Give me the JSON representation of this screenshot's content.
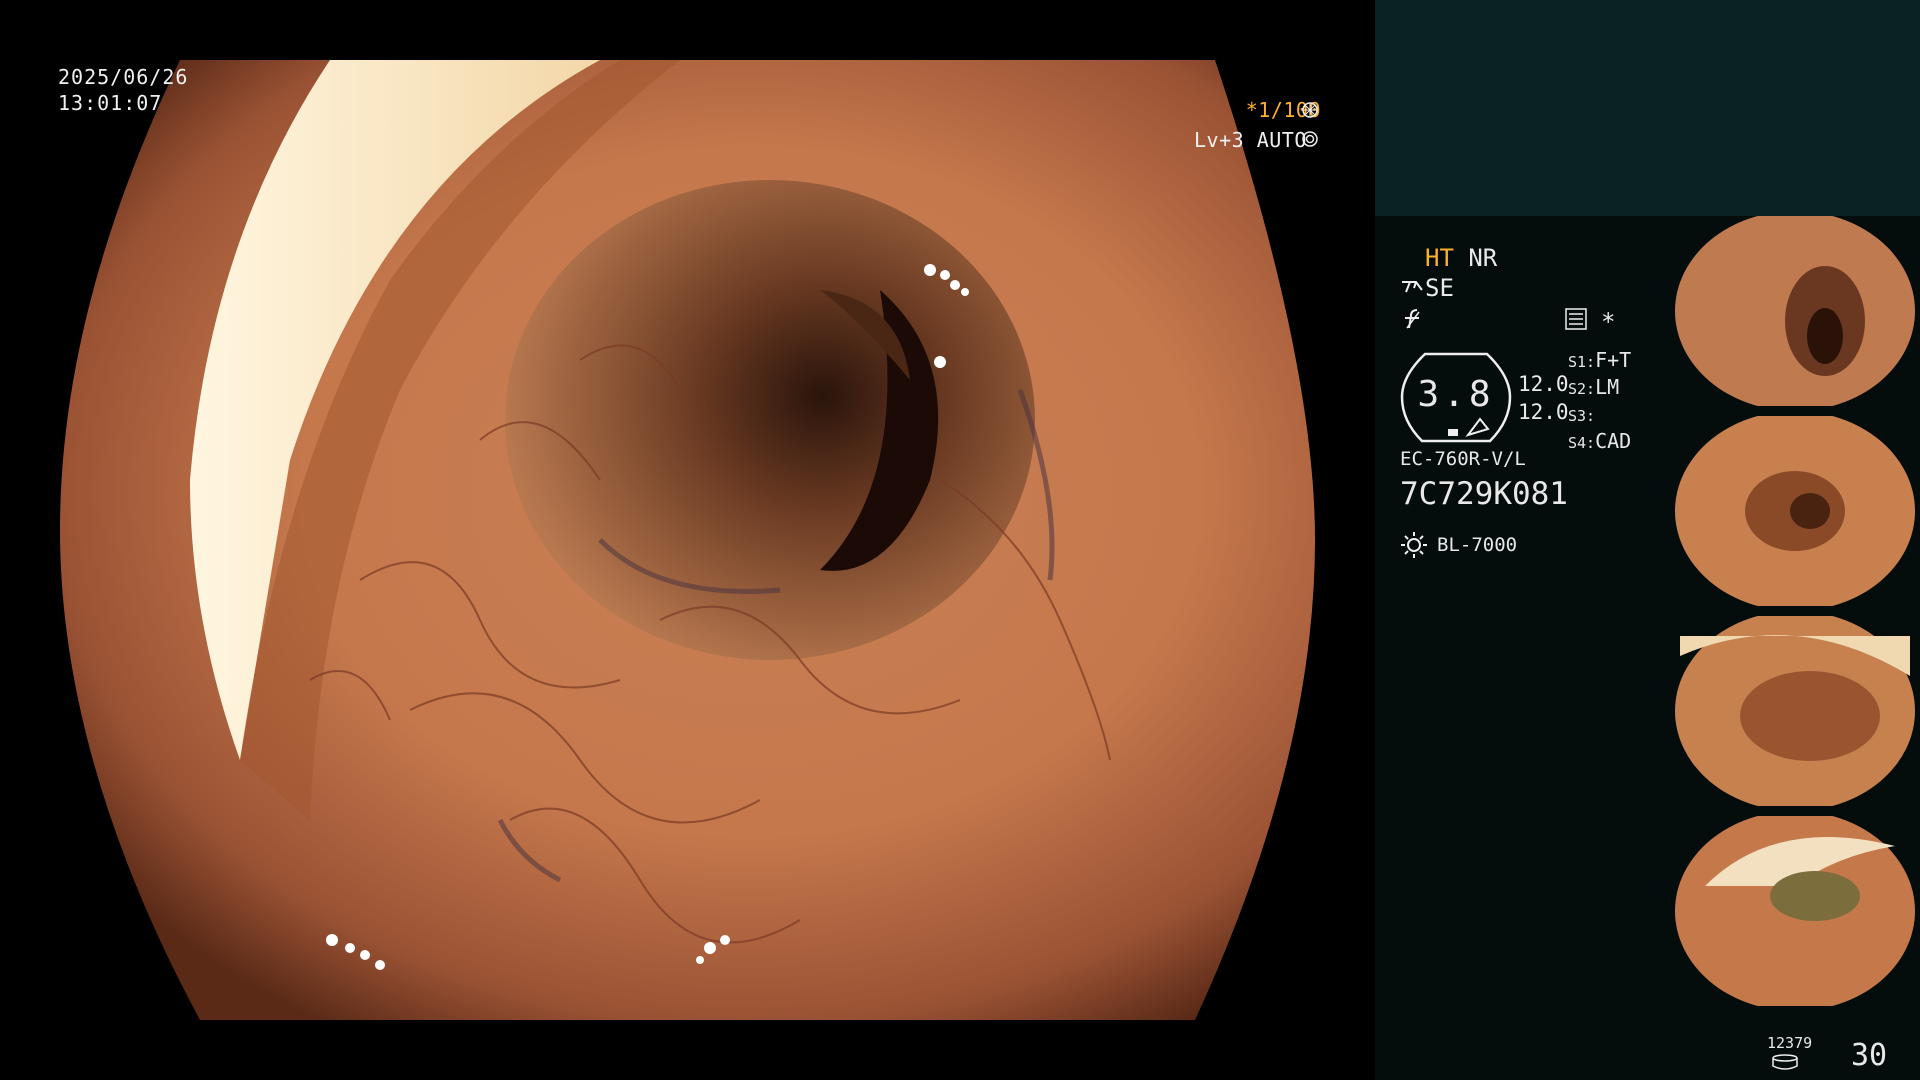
{
  "overlay": {
    "date": "2025/06/26",
    "time": "13:01:07",
    "shutter": "*1/100",
    "level": "Lv+3",
    "mode": "AUTO"
  },
  "processor": {
    "ht": "HT",
    "nr": "NR",
    "se": "SE",
    "gauge_value": "3.8",
    "val_top": "12.0",
    "val_bottom": "12.0",
    "s1_key": "S1:",
    "s1_val": "F+T",
    "s2_key": "S2:",
    "s2_val": "LM",
    "s3_key": "S3:",
    "s3_val": "",
    "s4_key": "S4:",
    "s4_val": "CAD",
    "scope_model": "EC-760R-V/L",
    "scope_serial": "7C729K081",
    "light_source": "BL-7000",
    "asterisk": "*"
  },
  "footer": {
    "storage_count": "12379",
    "frame_number": "30"
  },
  "icons": {
    "shutter": "aperture-icon",
    "auto": "target-icon",
    "se": "scope-tip-icon",
    "f": "function-icon",
    "settings": "settings-list-icon",
    "light": "sun-icon",
    "storage": "storage-disk-icon"
  },
  "colors": {
    "accent_orange": "#ffb030",
    "panel_top": "#0b2225",
    "panel": "#040c0c"
  }
}
